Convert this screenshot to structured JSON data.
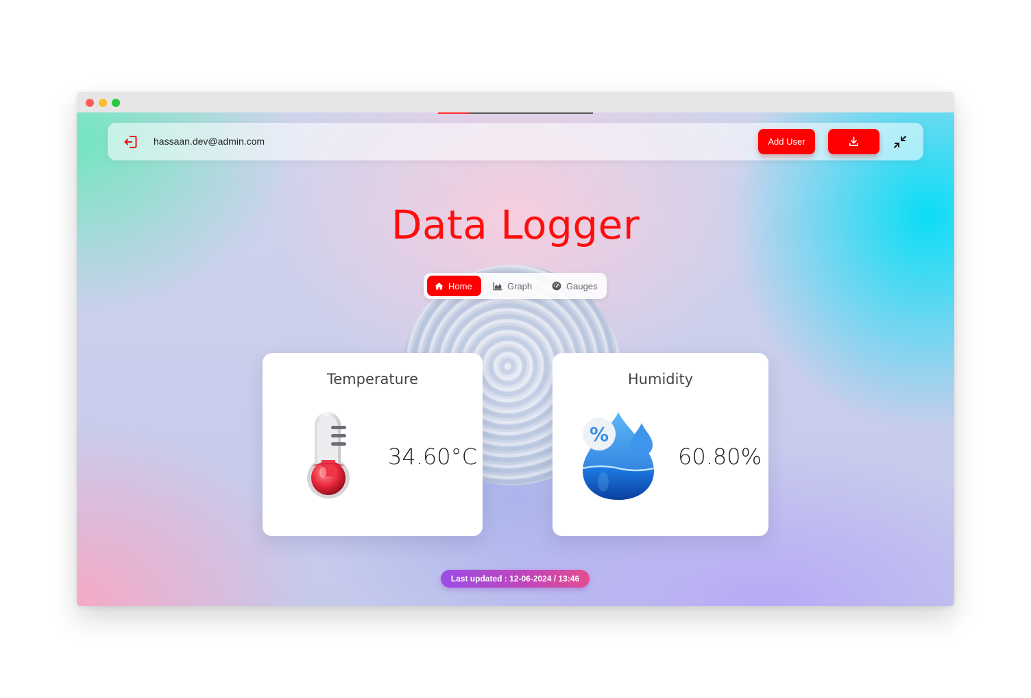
{
  "navbar": {
    "user_email": "hassaan.dev@admin.com",
    "add_user_label": "Add User",
    "logout_icon": "logout-icon",
    "download_icon": "download-icon",
    "collapse_icon": "fullscreen-exit-icon"
  },
  "loader": {
    "progress": 0.2
  },
  "app": {
    "title": "Data Logger"
  },
  "tabs": [
    {
      "label": "Home",
      "icon": "home-icon",
      "active": true
    },
    {
      "label": "Graph",
      "icon": "area-chart-icon",
      "active": false
    },
    {
      "label": "Gauges",
      "icon": "gauge-icon",
      "active": false
    }
  ],
  "cards": {
    "temperature": {
      "title": "Temperature",
      "value": "34.60°C",
      "icon": "thermometer-icon"
    },
    "humidity": {
      "title": "Humidity",
      "value": "60.80%",
      "icon": "humidity-drop-icon"
    }
  },
  "status": {
    "last_updated": "Last updated : 12-06-2024 / 13:46"
  },
  "colors": {
    "accent": "#ff0000",
    "title": "#ff0d0d",
    "badge_start": "#9b4ce6",
    "badge_end": "#e34d8e"
  }
}
